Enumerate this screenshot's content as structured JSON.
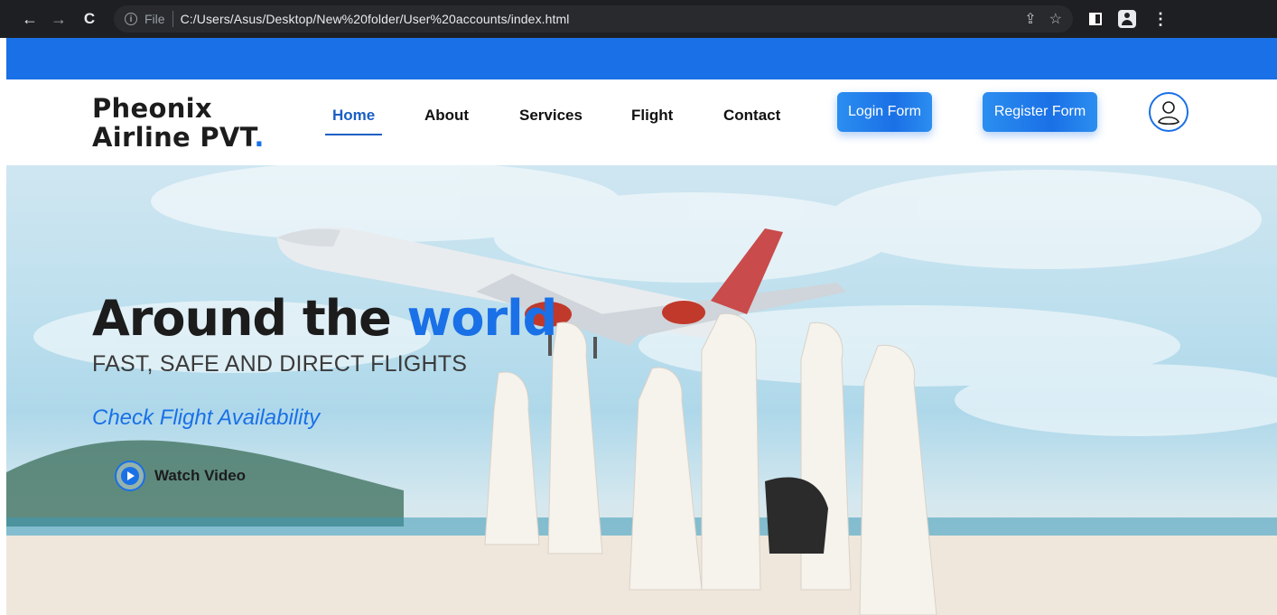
{
  "browser": {
    "back_icon": "←",
    "forward_icon": "→",
    "reload_icon": "C",
    "info_icon": "i",
    "scheme": "File",
    "url": "C:/Users/Asus/Desktop/New%20folder/User%20accounts/index.html",
    "share_icon": "⇪",
    "bookmark_icon": "☆",
    "menu_icon": "⋮"
  },
  "site": {
    "logo_line1": "Pheonix",
    "logo_line2": "Airline PVT",
    "logo_dot": "."
  },
  "nav": {
    "items": [
      "Home",
      "About",
      "Services",
      "Flight",
      "Contact"
    ],
    "active": "Home"
  },
  "actions": {
    "login": "Login Form",
    "register": "Register Form"
  },
  "hero": {
    "title_main": "Around the ",
    "title_accent": "world",
    "subtitle": "FAST, SAFE AND DIRECT FLIGHTS",
    "link": "Check Flight Availability",
    "watch": "Watch Video"
  },
  "colors": {
    "accent": "#1a70e6",
    "browser_bg": "#1e1f22",
    "text_dark": "#1c1c1c"
  }
}
